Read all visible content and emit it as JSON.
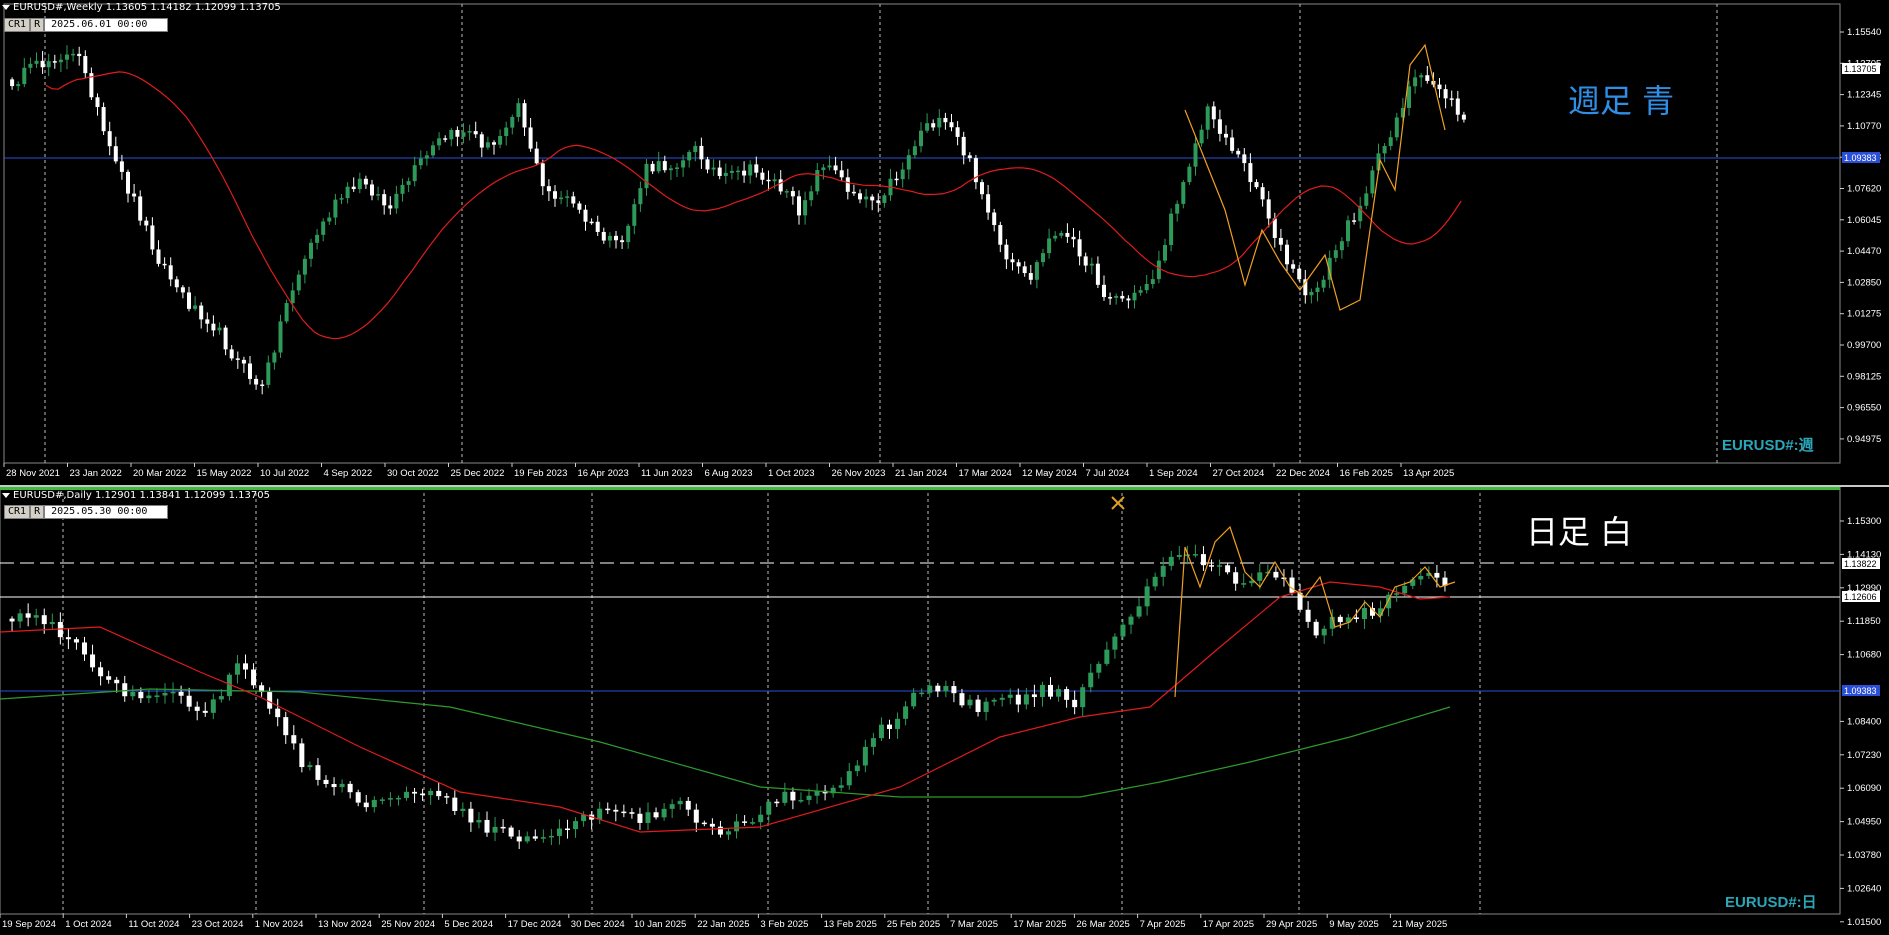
{
  "weekly": {
    "header_label": "EURUSD#,Weekly  1.13605 1.14182 1.12099 1.13705",
    "ctrl_buttons": [
      "CR1",
      "R"
    ],
    "datetime": "2025.06.01 00:00",
    "annotation": "週足  青",
    "watermark": "EURUSD#:週",
    "price_labels": [
      "1.15540",
      "1.13705",
      "1.12345",
      "1.10770",
      "1.09383",
      "1.07620",
      "1.06045",
      "1.04470",
      "1.02850",
      "1.01275",
      "0.99700",
      "0.98125",
      "0.96550",
      "0.94975"
    ],
    "current_price_tag": "1.13705",
    "hline_tag": "1.09383",
    "date_labels": [
      "28 Nov 2021",
      "23 Jan 2022",
      "20 Mar 2022",
      "15 May 2022",
      "10 Jul 2022",
      "4 Sep 2022",
      "30 Oct 2022",
      "25 Dec 2022",
      "19 Feb 2023",
      "16 Apr 2023",
      "11 Jun 2023",
      "6 Aug 2023",
      "1 Oct 2023",
      "26 Nov 2023",
      "21 Jan 2024",
      "17 Mar 2024",
      "12 May 2024",
      "7 Jul 2024",
      "1 Sep 2024",
      "27 Oct 2024",
      "22 Dec 2024",
      "16 Feb 2025",
      "13 Apr 2025"
    ],
    "colors": {
      "hline": "#2a4fd8",
      "ma": "#e01c1c",
      "zigzag": "#f0a020",
      "bull": "#2e9a5a",
      "bear": "#ffffff"
    }
  },
  "daily": {
    "header_label": "EURUSD#,Daily  1.12901 1.13841 1.12099 1.13705",
    "ctrl_buttons": [
      "CR1",
      "R"
    ],
    "datetime": "2025.05.30 00:00",
    "annotation": "日足  白",
    "watermark": "EURUSD#:日",
    "price_labels": [
      "1.15300",
      "1.14130",
      "1.12990",
      "1.11850",
      "1.10680",
      "1.09383",
      "1.08400",
      "1.07230",
      "1.06090",
      "1.04950",
      "1.03780",
      "1.02640",
      "1.01500"
    ],
    "current_price_tag": "1.13822",
    "white_line_tag": "1.12606",
    "hline_tag": "1.09383",
    "date_labels": [
      "19 Sep 2024",
      "1 Oct 2024",
      "11 Oct 2024",
      "23 Oct 2024",
      "1 Nov 2024",
      "13 Nov 2024",
      "25 Nov 2024",
      "5 Dec 2024",
      "17 Dec 2024",
      "30 Dec 2024",
      "10 Jan 2025",
      "22 Jan 2025",
      "3 Feb 2025",
      "13 Feb 2025",
      "25 Feb 2025",
      "7 Mar 2025",
      "17 Mar 2025",
      "26 Mar 2025",
      "7 Apr 2025",
      "17 Apr 2025",
      "29 Apr 2025",
      "9 May 2025",
      "21 May 2025"
    ],
    "colors": {
      "hline": "#2a4fd8",
      "ma_fast": "#e01c1c",
      "ma_slow": "#2e9a2e",
      "zigzag": "#f0a020",
      "bull": "#2e9a5a",
      "bear": "#ffffff"
    }
  }
}
